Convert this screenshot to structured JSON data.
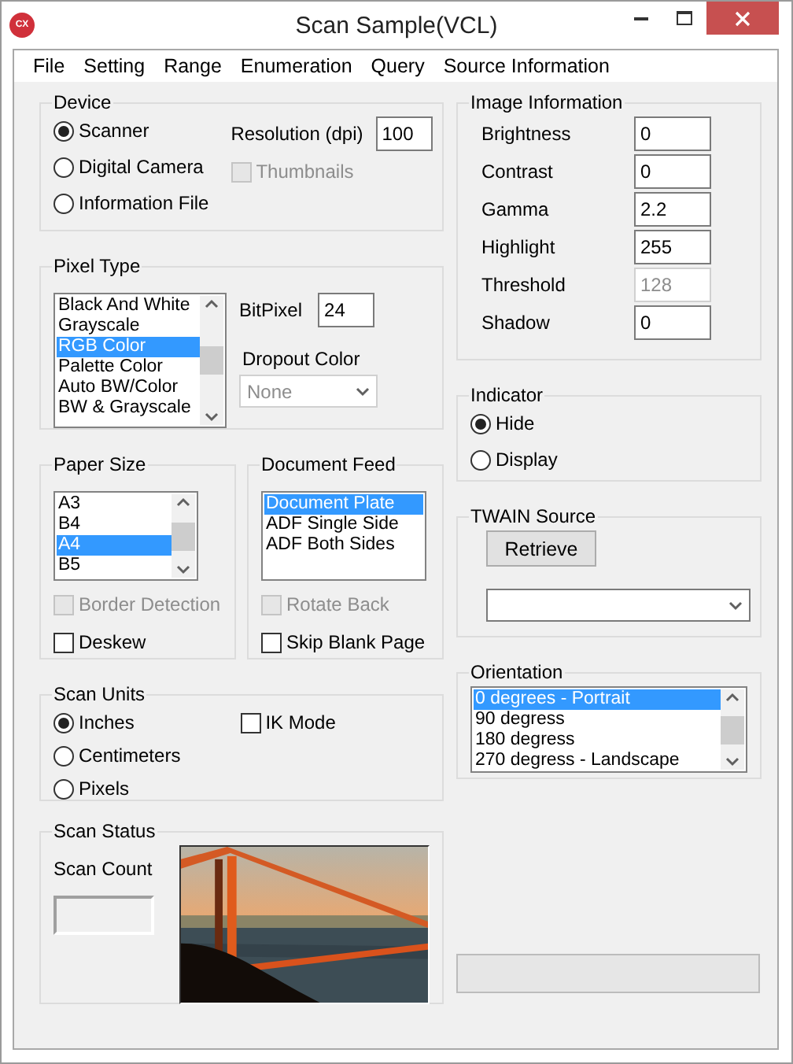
{
  "window": {
    "icon_text": "CX",
    "title": "Scan Sample(VCL)"
  },
  "menu": [
    "File",
    "Setting",
    "Range",
    "Enumeration",
    "Query",
    "Source Information"
  ],
  "device": {
    "title": "Device",
    "options": [
      {
        "label": "Scanner",
        "selected": true
      },
      {
        "label": "Digital Camera",
        "selected": false
      },
      {
        "label": "Information File",
        "selected": false
      }
    ],
    "resolution": {
      "label": "Resolution (dpi)",
      "value": "100"
    },
    "thumbnails": {
      "label": "Thumbnails",
      "checked": false,
      "disabled": true
    }
  },
  "pixel_type": {
    "title": "Pixel Type",
    "items": [
      {
        "label": "Black And White",
        "selected": false
      },
      {
        "label": "Grayscale",
        "selected": false
      },
      {
        "label": "RGB Color",
        "selected": true
      },
      {
        "label": "Palette Color",
        "selected": false
      },
      {
        "label": "Auto BW/Color",
        "selected": false
      },
      {
        "label": "BW & Grayscale",
        "selected": false
      }
    ],
    "bitpixel": {
      "label": "BitPixel",
      "value": "24"
    },
    "dropout": {
      "label": "Dropout Color",
      "value": "None",
      "disabled": true
    }
  },
  "paper_size": {
    "title": "Paper Size",
    "items": [
      {
        "label": "A3",
        "selected": false
      },
      {
        "label": "B4",
        "selected": false
      },
      {
        "label": "A4",
        "selected": true
      },
      {
        "label": "B5",
        "selected": false
      }
    ],
    "checks": [
      {
        "label": "Border Detection",
        "checked": false,
        "disabled": true
      },
      {
        "label": "Deskew",
        "checked": false,
        "disabled": false
      }
    ]
  },
  "document_feed": {
    "title": "Document Feed",
    "items": [
      {
        "label": "Document Plate",
        "selected": true
      },
      {
        "label": "ADF Single Side",
        "selected": false
      },
      {
        "label": "ADF Both Sides",
        "selected": false
      }
    ],
    "checks": [
      {
        "label": "Rotate Back",
        "checked": false,
        "disabled": true
      },
      {
        "label": "Skip Blank Page",
        "checked": false,
        "disabled": false
      }
    ]
  },
  "scan_units": {
    "title": "Scan Units",
    "options": [
      {
        "label": "Inches",
        "selected": true
      },
      {
        "label": "Centimeters",
        "selected": false
      },
      {
        "label": "Pixels",
        "selected": false
      }
    ],
    "ik_mode": {
      "label": "IK Mode",
      "checked": false
    }
  },
  "scan_status": {
    "title": "Scan Status",
    "count_label": "Scan Count"
  },
  "image_information": {
    "title": "Image Information",
    "fields": [
      {
        "label": "Brightness",
        "value": "0",
        "disabled": false
      },
      {
        "label": "Contrast",
        "value": "0",
        "disabled": false
      },
      {
        "label": "Gamma",
        "value": "2.2",
        "disabled": false
      },
      {
        "label": "Highlight",
        "value": "255",
        "disabled": false
      },
      {
        "label": "Threshold",
        "value": "128",
        "disabled": true
      },
      {
        "label": "Shadow",
        "value": "0",
        "disabled": false
      }
    ]
  },
  "indicator": {
    "title": "Indicator",
    "options": [
      {
        "label": "Hide",
        "selected": true
      },
      {
        "label": "Display",
        "selected": false
      }
    ]
  },
  "twain_source": {
    "title": "TWAIN Source",
    "button": "Retrieve"
  },
  "orientation": {
    "title": "Orientation",
    "items": [
      {
        "label": "0 degrees - Portrait",
        "selected": true
      },
      {
        "label": "90 degress",
        "selected": false
      },
      {
        "label": "180 degress",
        "selected": false
      },
      {
        "label": "270 degress - Landscape",
        "selected": false
      }
    ]
  },
  "progress": {
    "level": 0
  }
}
